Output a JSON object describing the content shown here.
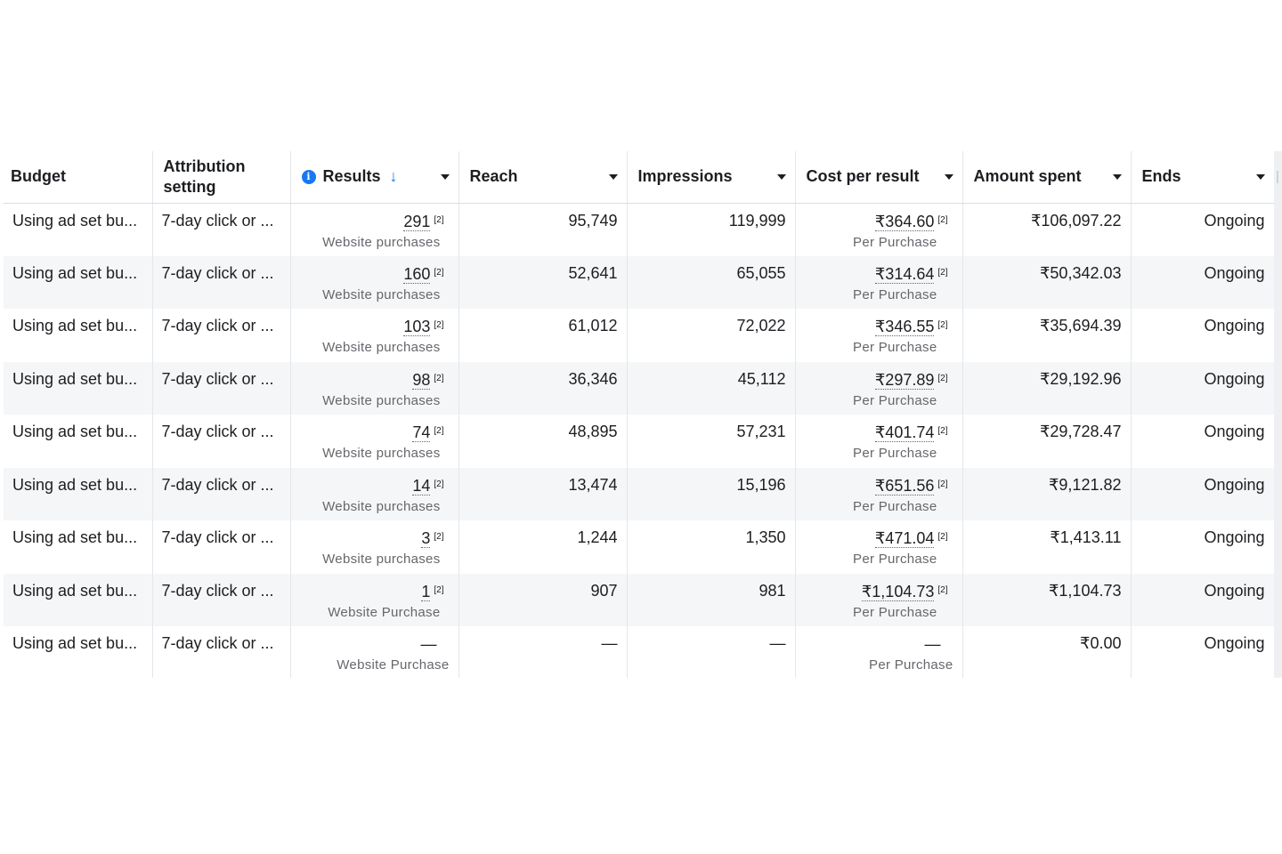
{
  "columns": [
    {
      "key": "budget",
      "label": "Budget"
    },
    {
      "key": "attribution",
      "label": "Attribution setting"
    },
    {
      "key": "results",
      "label": "Results"
    },
    {
      "key": "reach",
      "label": "Reach"
    },
    {
      "key": "impressions",
      "label": "Impressions"
    },
    {
      "key": "cost_per_result",
      "label": "Cost per result"
    },
    {
      "key": "amount_spent",
      "label": "Amount spent"
    },
    {
      "key": "ends",
      "label": "Ends"
    }
  ],
  "icons": {
    "results_info": "info-icon",
    "results_sort": "sort-descending-icon",
    "column_menu": "caret-down-icon"
  },
  "colors": {
    "accent": "#1877f2",
    "row_alt": "#f5f6f7",
    "muted_text": "#65676b"
  },
  "rows": [
    {
      "budget": "Using ad set bu...",
      "attribution": "7-day click or ...",
      "results": "291",
      "results_note": "[2]",
      "results_label": "Website purchases",
      "reach": "95,749",
      "impressions": "119,999",
      "cost": "₹364.60",
      "cost_note": "[2]",
      "cost_label": "Per Purchase",
      "spent": "₹106,097.22",
      "ends": "Ongoing"
    },
    {
      "budget": "Using ad set bu...",
      "attribution": "7-day click or ...",
      "results": "160",
      "results_note": "[2]",
      "results_label": "Website purchases",
      "reach": "52,641",
      "impressions": "65,055",
      "cost": "₹314.64",
      "cost_note": "[2]",
      "cost_label": "Per Purchase",
      "spent": "₹50,342.03",
      "ends": "Ongoing"
    },
    {
      "budget": "Using ad set bu...",
      "attribution": "7-day click or ...",
      "results": "103",
      "results_note": "[2]",
      "results_label": "Website purchases",
      "reach": "61,012",
      "impressions": "72,022",
      "cost": "₹346.55",
      "cost_note": "[2]",
      "cost_label": "Per Purchase",
      "spent": "₹35,694.39",
      "ends": "Ongoing"
    },
    {
      "budget": "Using ad set bu...",
      "attribution": "7-day click or ...",
      "results": "98",
      "results_note": "[2]",
      "results_label": "Website purchases",
      "reach": "36,346",
      "impressions": "45,112",
      "cost": "₹297.89",
      "cost_note": "[2]",
      "cost_label": "Per Purchase",
      "spent": "₹29,192.96",
      "ends": "Ongoing"
    },
    {
      "budget": "Using ad set bu...",
      "attribution": "7-day click or ...",
      "results": "74",
      "results_note": "[2]",
      "results_label": "Website purchases",
      "reach": "48,895",
      "impressions": "57,231",
      "cost": "₹401.74",
      "cost_note": "[2]",
      "cost_label": "Per Purchase",
      "spent": "₹29,728.47",
      "ends": "Ongoing"
    },
    {
      "budget": "Using ad set bu...",
      "attribution": "7-day click or ...",
      "results": "14",
      "results_note": "[2]",
      "results_label": "Website purchases",
      "reach": "13,474",
      "impressions": "15,196",
      "cost": "₹651.56",
      "cost_note": "[2]",
      "cost_label": "Per Purchase",
      "spent": "₹9,121.82",
      "ends": "Ongoing"
    },
    {
      "budget": "Using ad set bu...",
      "attribution": "7-day click or ...",
      "results": "3",
      "results_note": "[2]",
      "results_label": "Website purchases",
      "reach": "1,244",
      "impressions": "1,350",
      "cost": "₹471.04",
      "cost_note": "[2]",
      "cost_label": "Per Purchase",
      "spent": "₹1,413.11",
      "ends": "Ongoing"
    },
    {
      "budget": "Using ad set bu...",
      "attribution": "7-day click or ...",
      "results": "1",
      "results_note": "[2]",
      "results_label": "Website Purchase",
      "reach": "907",
      "impressions": "981",
      "cost": "₹1,104.73",
      "cost_note": "[2]",
      "cost_label": "Per Purchase",
      "spent": "₹1,104.73",
      "ends": "Ongoing"
    },
    {
      "budget": "Using ad set bu...",
      "attribution": "7-day click or ...",
      "results": "—",
      "results_note": "",
      "results_label": "Website Purchase",
      "reach": "—",
      "impressions": "—",
      "cost": "—",
      "cost_note": "",
      "cost_label": "Per Purchase",
      "spent": "₹0.00",
      "ends": "Ongoing"
    }
  ]
}
